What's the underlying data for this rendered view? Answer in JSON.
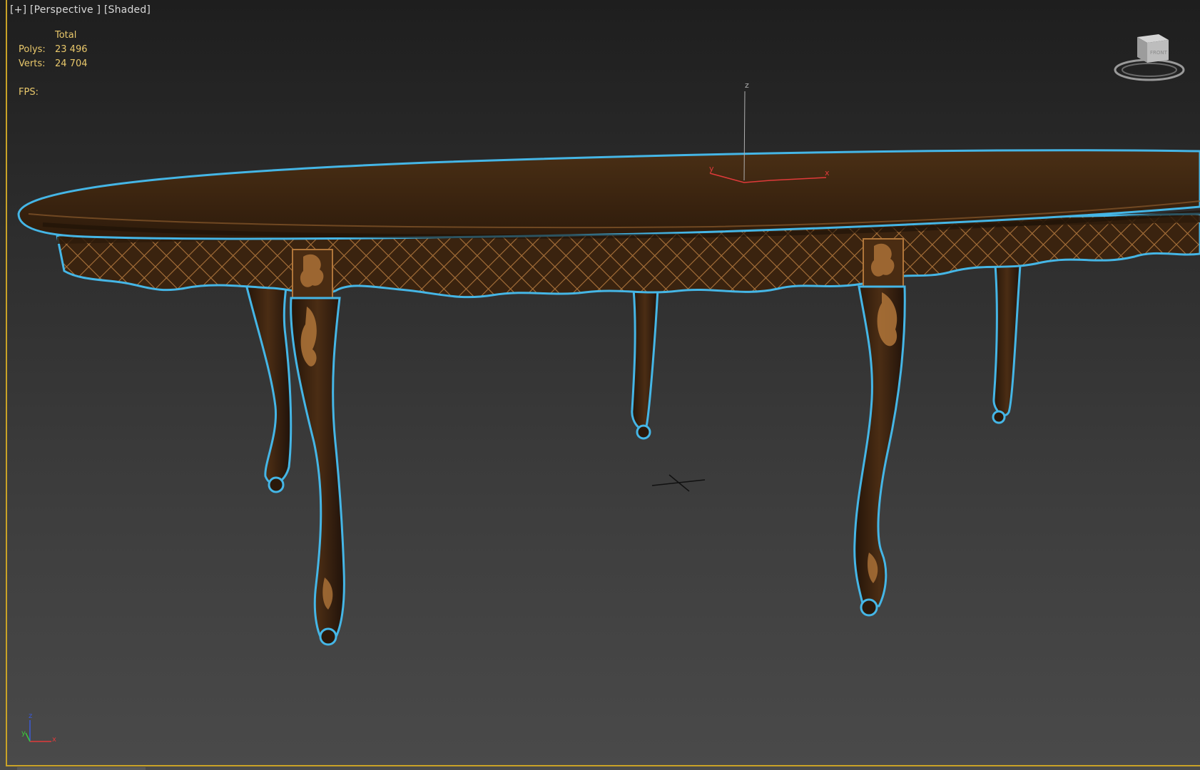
{
  "viewport": {
    "label_plus": "[+]",
    "label_view": "[Perspective ]",
    "label_shading": "[Shaded]"
  },
  "stats": {
    "header": "Total",
    "polys_label": "Polys:",
    "polys_value": "23 496",
    "verts_label": "Verts:",
    "verts_value": "24 704",
    "fps_label": "FPS:"
  },
  "viewcube": {
    "face_label": "FRONT",
    "icon": "viewcube-icon"
  },
  "gizmo": {
    "x_label": "x",
    "y_label": "y",
    "z_label": "z"
  },
  "axis_tripod": {
    "x_label": "x",
    "y_label": "y",
    "z_label": "z"
  },
  "colors": {
    "selection_outline": "#45b6e6",
    "wood": "#3e2612",
    "inlay": "#b0763a",
    "stats_text": "#e9c86b",
    "frame_border": "#c9a227",
    "gizmo_x": "#e03a3a",
    "gizmo_z": "#b0b0b0"
  },
  "scene": {
    "object": "oval-dining-table",
    "selected": true
  }
}
